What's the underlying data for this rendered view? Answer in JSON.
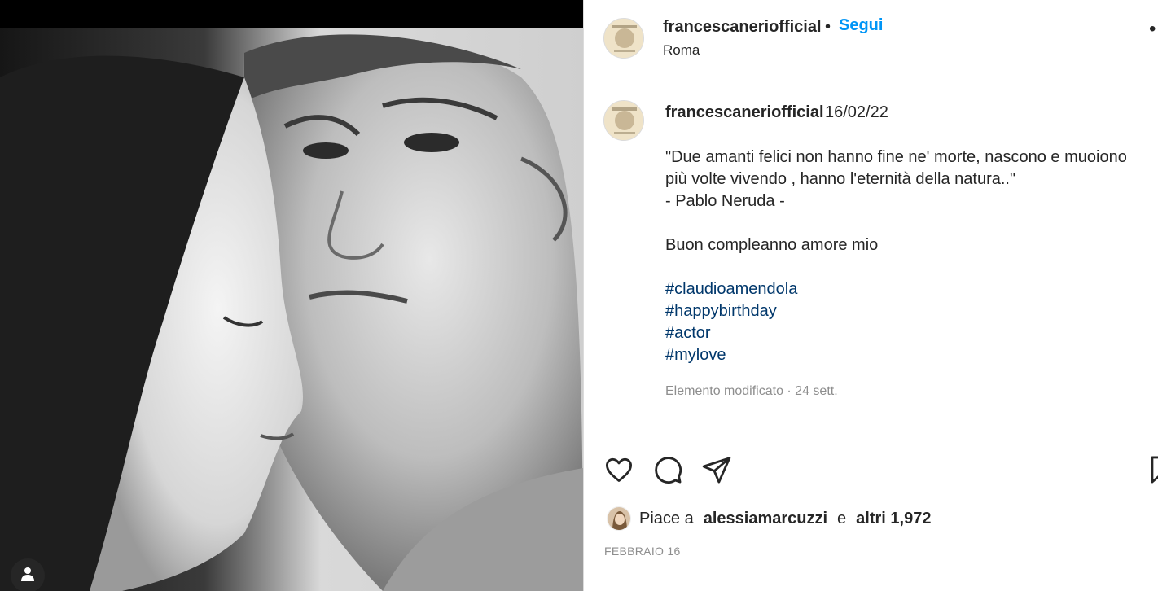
{
  "post": {
    "header": {
      "username": "francescaneriofficial",
      "separator": "•",
      "follow_label": "Segui",
      "location": "Roma",
      "more_label": "…"
    },
    "caption": {
      "username": "francescaneriofficial",
      "date": "16/02/22",
      "lines": [
        "\"Due amanti felici non hanno fine ne' morte, nascono e muoiono",
        "più volte vivendo , hanno l'eternità della natura..\"",
        "- Pablo Neruda -"
      ],
      "message": "Buon compleanno amore mio",
      "hashtags": [
        "#claudioamendola",
        "#happybirthday",
        "#actor",
        "#mylove"
      ],
      "meta": "Elemento modificato · 24 sett."
    },
    "likes": {
      "prefix": "Piace a",
      "first_liker": "alessiamarcuzzi",
      "conjunction": "e",
      "others": "altri 1,972"
    },
    "date_label": "FEBBRAIO 16"
  },
  "icons": {
    "like": "heart-icon",
    "comment": "comment-icon",
    "share": "paper-plane-icon",
    "save": "bookmark-icon",
    "user_tags": "person-icon",
    "more": "more-options-icon"
  },
  "colors": {
    "follow_blue": "#0095f6",
    "hashtag_blue": "#00376b",
    "muted_text": "#8e8e8e",
    "border": "#dbdbdb"
  }
}
